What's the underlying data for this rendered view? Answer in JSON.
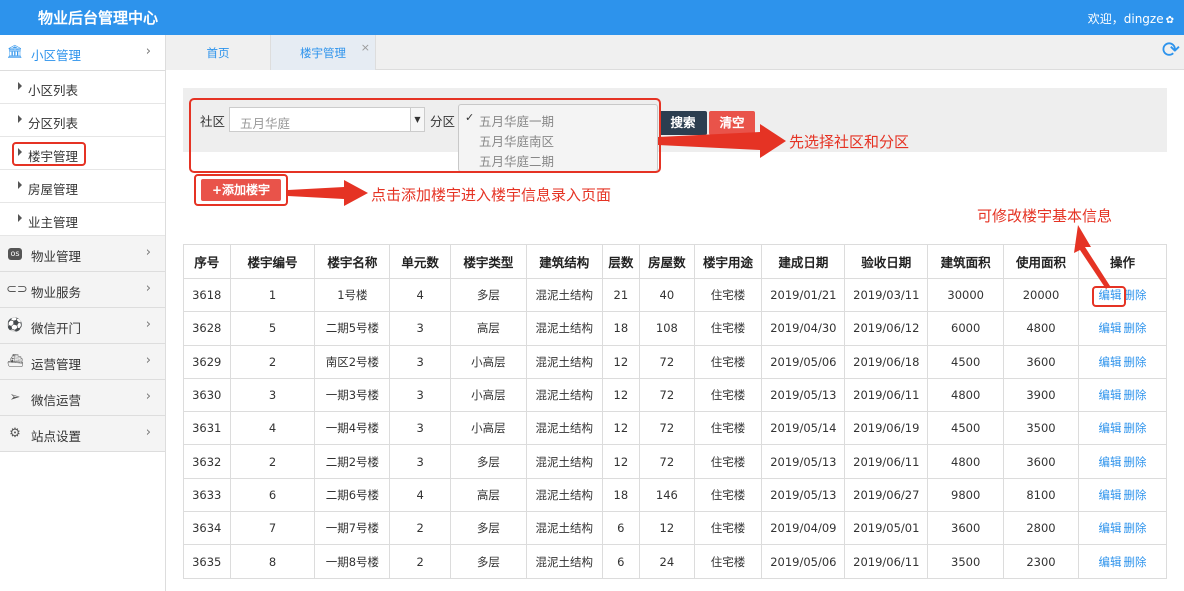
{
  "app": {
    "title": "物业后台管理中心",
    "welcome": "欢迎，dingze",
    "welcome_icon": "gear-icon"
  },
  "sidebar": {
    "sections": [
      {
        "label": "小区管理",
        "icon": "bank-icon",
        "active": true
      },
      {
        "label": "物业管理",
        "icon": "os-icon"
      },
      {
        "label": "物业服务",
        "icon": "toggle-icon"
      },
      {
        "label": "微信开门",
        "icon": "soccer-icon"
      },
      {
        "label": "运营管理",
        "icon": "ship-icon"
      },
      {
        "label": "微信运营",
        "icon": "paper-plane-icon"
      },
      {
        "label": "站点设置",
        "icon": "cogs-icon"
      }
    ],
    "subitems": [
      {
        "label": "小区列表"
      },
      {
        "label": "分区列表"
      },
      {
        "label": "楼宇管理",
        "highlighted": true
      },
      {
        "label": "房屋管理"
      },
      {
        "label": "业主管理"
      }
    ]
  },
  "tabs": [
    {
      "label": "首页"
    },
    {
      "label": "楼宇管理",
      "close": "×"
    }
  ],
  "filter": {
    "community_label": "社区",
    "community_value": "五月华庭",
    "district_label": "分区",
    "district_options": [
      "五月华庭一期",
      "五月华庭南区",
      "五月华庭二期"
    ],
    "selected_index": 0,
    "search_label": "搜索",
    "clear_label": "清空"
  },
  "add_button": "+添加楼宇",
  "annotations": {
    "select": "先选择社区和分区",
    "add": "点击添加楼宇进入楼宇信息录入页面",
    "edit": "可修改楼宇基本信息"
  },
  "table": {
    "headers": [
      "序号",
      "楼宇编号",
      "楼宇名称",
      "单元数",
      "楼宇类型",
      "建筑结构",
      "层数",
      "房屋数",
      "楼宇用途",
      "建成日期",
      "验收日期",
      "建筑面积",
      "使用面积",
      "操作"
    ],
    "edit_label": "编辑",
    "delete_label": "删除",
    "rows": [
      [
        "3618",
        "1",
        "1号楼",
        "4",
        "多层",
        "混泥土结构",
        "21",
        "40",
        "住宅楼",
        "2019/01/21",
        "2019/03/11",
        "30000",
        "20000"
      ],
      [
        "3628",
        "5",
        "二期5号楼",
        "3",
        "高层",
        "混泥土结构",
        "18",
        "108",
        "住宅楼",
        "2019/04/30",
        "2019/06/12",
        "6000",
        "4800"
      ],
      [
        "3629",
        "2",
        "南区2号楼",
        "3",
        "小高层",
        "混泥土结构",
        "12",
        "72",
        "住宅楼",
        "2019/05/06",
        "2019/06/18",
        "4500",
        "3600"
      ],
      [
        "3630",
        "3",
        "一期3号楼",
        "3",
        "小高层",
        "混泥土结构",
        "12",
        "72",
        "住宅楼",
        "2019/05/13",
        "2019/06/11",
        "4800",
        "3900"
      ],
      [
        "3631",
        "4",
        "一期4号楼",
        "3",
        "小高层",
        "混泥土结构",
        "12",
        "72",
        "住宅楼",
        "2019/05/14",
        "2019/06/19",
        "4500",
        "3500"
      ],
      [
        "3632",
        "2",
        "二期2号楼",
        "3",
        "多层",
        "混泥土结构",
        "12",
        "72",
        "住宅楼",
        "2019/05/13",
        "2019/06/11",
        "4800",
        "3600"
      ],
      [
        "3633",
        "6",
        "二期6号楼",
        "4",
        "高层",
        "混泥土结构",
        "18",
        "146",
        "住宅楼",
        "2019/05/13",
        "2019/06/27",
        "9800",
        "8100"
      ],
      [
        "3634",
        "7",
        "一期7号楼",
        "2",
        "多层",
        "混泥土结构",
        "6",
        "12",
        "住宅楼",
        "2019/04/09",
        "2019/05/01",
        "3600",
        "2800"
      ],
      [
        "3635",
        "8",
        "一期8号楼",
        "2",
        "多层",
        "混泥土结构",
        "6",
        "24",
        "住宅楼",
        "2019/05/06",
        "2019/06/11",
        "3500",
        "2300"
      ]
    ]
  }
}
